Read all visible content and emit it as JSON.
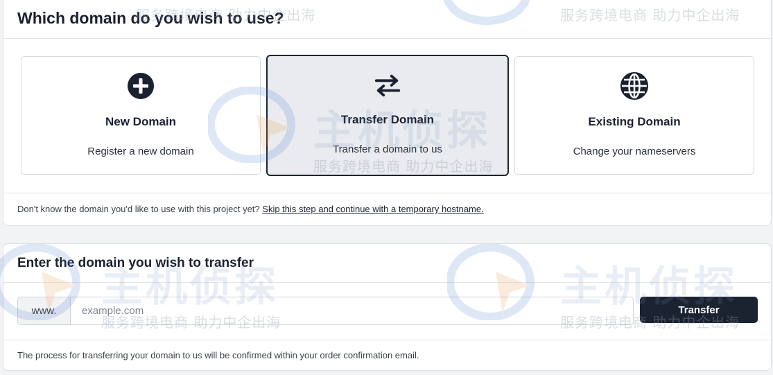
{
  "domain_select": {
    "heading": "Which domain do you wish to use?",
    "options": [
      {
        "id": "new",
        "icon": "plus-circle-icon",
        "title": "New Domain",
        "description": "Register a new domain",
        "selected": false
      },
      {
        "id": "transfer",
        "icon": "arrows-exchange-icon",
        "title": "Transfer Domain",
        "description": "Transfer a domain to us",
        "selected": true
      },
      {
        "id": "existing",
        "icon": "globe-icon",
        "title": "Existing Domain",
        "description": "Change your nameservers",
        "selected": false
      }
    ],
    "hint_text": "Don't know the domain you'd like to use with this project yet?",
    "skip_link": "Skip this step and continue with a temporary hostname."
  },
  "transfer_form": {
    "heading": "Enter the domain you wish to transfer",
    "prefix": "www.",
    "input_placeholder": "example.com",
    "input_value": "",
    "button_label": "Transfer",
    "note": "The process for transferring your domain to us will be confirmed within your order confirmation email."
  },
  "watermark": {
    "slogan": "服务跨境电商 助力中企出海",
    "brand": "主机侦探"
  },
  "colors": {
    "primary_dark": "#1b2230",
    "selected_card_bg": "#e9ebee",
    "border": "#d6d9de"
  }
}
